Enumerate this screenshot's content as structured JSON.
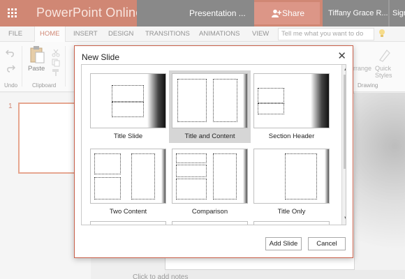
{
  "titlebar": {
    "app_name": "PowerPoint Online",
    "document_name": "Presentation ...",
    "share_label": "Share",
    "user_name": "Tiffany Grace R...",
    "sign_out": "Sign out"
  },
  "tabs": [
    {
      "label": "FILE"
    },
    {
      "label": "HOME"
    },
    {
      "label": "INSERT"
    },
    {
      "label": "DESIGN"
    },
    {
      "label": "TRANSITIONS"
    },
    {
      "label": "ANIMATIONS"
    },
    {
      "label": "VIEW"
    }
  ],
  "active_tab": "HOME",
  "tell_me": {
    "placeholder": "Tell me what you want to do"
  },
  "ribbon": {
    "paste_label": "Paste",
    "group_undo": "Undo",
    "group_clipboard": "Clipboard",
    "group_drawing": "Drawing",
    "arrange_label": "rrange",
    "quick_styles_label": "Quick Styles"
  },
  "slides": {
    "current_number": "1"
  },
  "notes": {
    "placeholder": "Click to add notes"
  },
  "dialog": {
    "title": "New Slide",
    "layouts": [
      {
        "label": "Title Slide",
        "selected": false
      },
      {
        "label": "Title and Content",
        "selected": true
      },
      {
        "label": "Section Header",
        "selected": false
      },
      {
        "label": "Two Content",
        "selected": false
      },
      {
        "label": "Comparison",
        "selected": false
      },
      {
        "label": "Title Only",
        "selected": false
      }
    ],
    "add_button": "Add Slide",
    "cancel_button": "Cancel"
  },
  "colors": {
    "brand": "#b7472a",
    "share_button": "#c95f48",
    "dark_bar": "#4a4a4a",
    "selected_layout": "#d6d6d6"
  }
}
